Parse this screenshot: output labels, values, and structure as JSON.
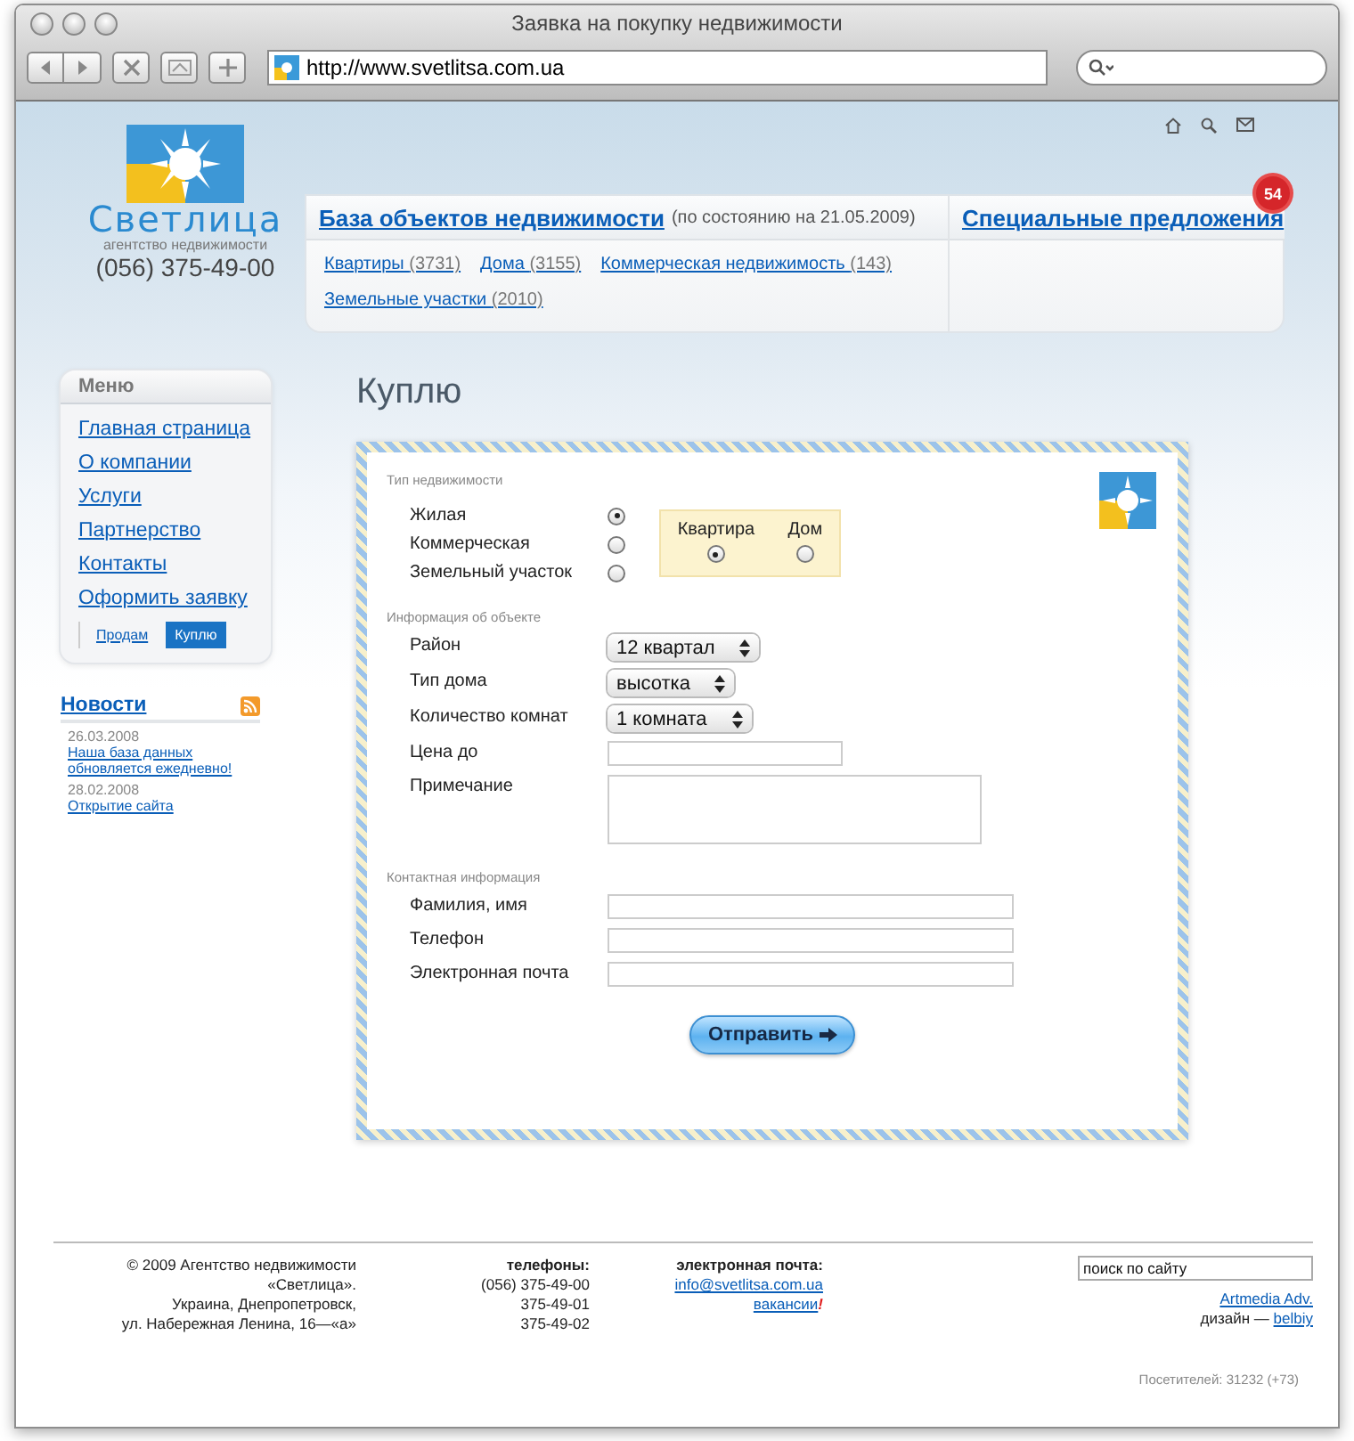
{
  "window": {
    "title": "Заявка на покупку недвижимости",
    "url": "http://www.svetlitsa.com.ua"
  },
  "header": {
    "logo_name": "Светлица",
    "logo_tagline": "агентство недвижимости",
    "phone": "(056) 375-49-00",
    "database": {
      "title": "База объектов недвижимости",
      "note": "(по состоянию на 21.05.2009)",
      "categories": [
        {
          "label": "Квартиры",
          "count": "(3731)"
        },
        {
          "label": "Дома",
          "count": "(3155)"
        },
        {
          "label": "Коммерческая недвижимость",
          "count": "(143)"
        },
        {
          "label": "Земельные участки",
          "count": "(2010)"
        }
      ]
    },
    "special": {
      "title": "Специальные предложения",
      "badge": "54"
    }
  },
  "menu": {
    "title": "Меню",
    "items": [
      "Главная страница",
      "О компании",
      "Услуги",
      "Партнерство",
      "Контакты",
      "Оформить заявку"
    ],
    "subitems": [
      {
        "label": "Продам",
        "selected": false
      },
      {
        "label": "Куплю",
        "selected": true
      }
    ]
  },
  "news": {
    "title": "Новости",
    "items": [
      {
        "date": "26.03.2008",
        "title": "Наша база данных обновляется ежедневно!"
      },
      {
        "date": "28.02.2008",
        "title": "Открытие сайта"
      }
    ]
  },
  "page_title": "Куплю",
  "form": {
    "type_section": "Тип недвижимости",
    "property_types": [
      {
        "label": "Жилая",
        "selected": true
      },
      {
        "label": "Коммерческая",
        "selected": false
      },
      {
        "label": "Земельный участок",
        "selected": false
      }
    ],
    "subtypes": [
      {
        "label": "Квартира",
        "selected": true
      },
      {
        "label": "Дом",
        "selected": false
      }
    ],
    "object_section": "Информация об объекте",
    "object_fields": [
      {
        "kind": "select",
        "label": "Район",
        "value": "12 квартал"
      },
      {
        "kind": "select",
        "label": "Тип дома",
        "value": "высотка"
      },
      {
        "kind": "select",
        "label": "Количество комнат",
        "value": "1 комната"
      },
      {
        "kind": "text",
        "label": "Цена до"
      },
      {
        "kind": "textarea",
        "label": "Примечание"
      }
    ],
    "contact_section": "Контактная информация",
    "contact_fields": [
      {
        "kind": "text",
        "label": "Фамилия, имя"
      },
      {
        "kind": "text",
        "label": "Телефон"
      },
      {
        "kind": "text",
        "label": "Электронная почта"
      }
    ],
    "submit": "Отправить"
  },
  "footer": {
    "address": [
      "© 2009 Агентство недвижимости",
      "«Светлица».",
      "Украина, Днепропетровск,",
      "ул. Набережная Ленина, 16—«а»"
    ],
    "phones_title": "телефоны:",
    "phones": [
      "(056) 375-49-00",
      "375-49-01",
      "375-49-02"
    ],
    "email_title": "электронная почта:",
    "email": "info@svetlitsa.com.ua",
    "vacancies": "вакансии",
    "vacancies_mark": "!",
    "search": {
      "placeholder": "поиск по сайту"
    },
    "developer": "Artmedia Adv.",
    "design_label": "дизайн —",
    "designer": "belbiy",
    "visitors": "Посетителей: 31232 (+73)"
  }
}
